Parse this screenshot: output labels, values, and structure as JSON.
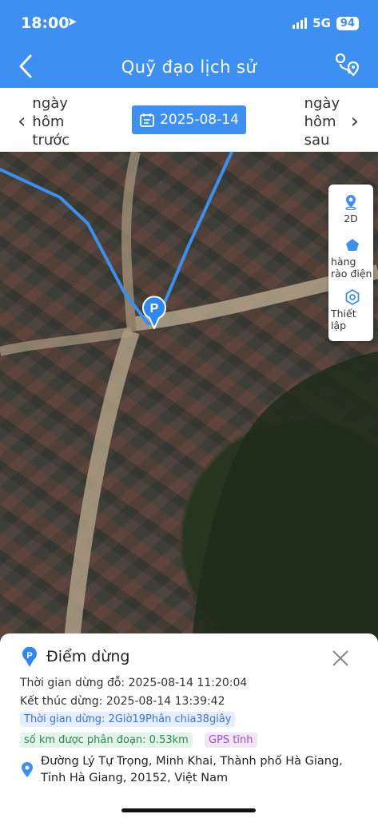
{
  "status_bar": {
    "time": "18:00",
    "network": "5G",
    "battery": "94"
  },
  "header": {
    "title": "Quỹ đạo lịch sử"
  },
  "date_nav": {
    "prev_label": "ngày hôm trước",
    "current_date": "2025-08-14",
    "next_label": "ngày hôm sau"
  },
  "map_panel": {
    "mode_2d": "2D",
    "fence": "hàng rào điện",
    "settings": "Thiết lập"
  },
  "stop_marker": {
    "label": "P"
  },
  "stop_sheet": {
    "title": "Điểm dừng",
    "stop_start_label": "Thời gian dừng đỗ:",
    "stop_start_value": "2025-08-14 11:20:04",
    "stop_end_label": "Kết thúc dừng:",
    "stop_end_value": "2025-08-14 13:39:42",
    "stop_duration": "Thời gian dừng: 2Giờ19Phân chia38giây",
    "segment_km": "số km được phân đoạn: 0.53km",
    "gps_status": "GPS tĩnh",
    "address": "Đường Lý Tự Trọng, Minh Khai, Thành phố Hà Giang, Tỉnh Hà Giang, 20152, Việt Nam"
  },
  "colors": {
    "primary": "#3d8ff2",
    "route": "#3b8ff0"
  }
}
